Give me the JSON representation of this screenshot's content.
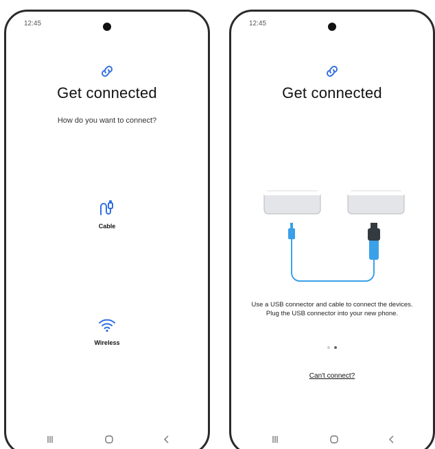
{
  "colors": {
    "accent": "#2f6fe0",
    "cable_blue": "#3aa0e8",
    "connector_dark": "#333a40",
    "device_gray": "#e3e5e8"
  },
  "left_screen": {
    "status_time": "12:45",
    "link_icon": "link-icon",
    "title": "Get connected",
    "subtitle": "How do you want to connect?",
    "options": [
      {
        "icon": "cable-icon",
        "label": "Cable"
      },
      {
        "icon": "wifi-icon",
        "label": "Wireless"
      }
    ],
    "nav": {
      "recent": "|||",
      "home": "○",
      "back": "<"
    }
  },
  "right_screen": {
    "status_time": "12:45",
    "link_icon": "link-icon",
    "title": "Get connected",
    "instructions": "Use a USB connector and cable to connect the devices. Plug the USB connector into your new phone.",
    "pages": {
      "count": 2,
      "current": 2
    },
    "cant_connect": "Can't connect?",
    "nav": {
      "recent": "|||",
      "home": "○",
      "back": "<"
    }
  }
}
